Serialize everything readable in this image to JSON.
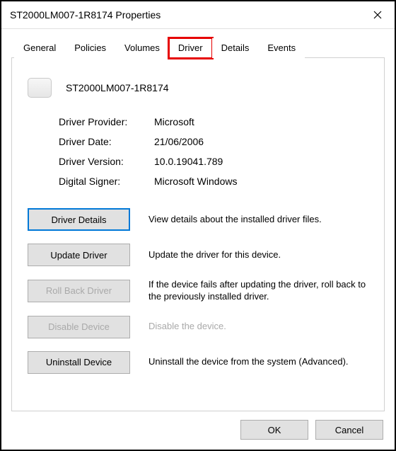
{
  "window": {
    "title": "ST2000LM007-1R8174 Properties"
  },
  "tabs": {
    "general": "General",
    "policies": "Policies",
    "volumes": "Volumes",
    "driver": "Driver",
    "details": "Details",
    "events": "Events",
    "active": "driver",
    "highlighted": "driver"
  },
  "device": {
    "name": "ST2000LM007-1R8174"
  },
  "info": {
    "provider_label": "Driver Provider:",
    "provider_value": "Microsoft",
    "date_label": "Driver Date:",
    "date_value": "21/06/2006",
    "version_label": "Driver Version:",
    "version_value": "10.0.19041.789",
    "signer_label": "Digital Signer:",
    "signer_value": "Microsoft Windows"
  },
  "actions": {
    "details": {
      "label": "Driver Details",
      "desc": "View details about the installed driver files."
    },
    "update": {
      "label": "Update Driver",
      "desc": "Update the driver for this device."
    },
    "rollback": {
      "label": "Roll Back Driver",
      "desc": "If the device fails after updating the driver, roll back to the previously installed driver."
    },
    "disable": {
      "label": "Disable Device",
      "desc": "Disable the device."
    },
    "uninstall": {
      "label": "Uninstall Device",
      "desc": "Uninstall the device from the system (Advanced)."
    }
  },
  "footer": {
    "ok": "OK",
    "cancel": "Cancel"
  }
}
